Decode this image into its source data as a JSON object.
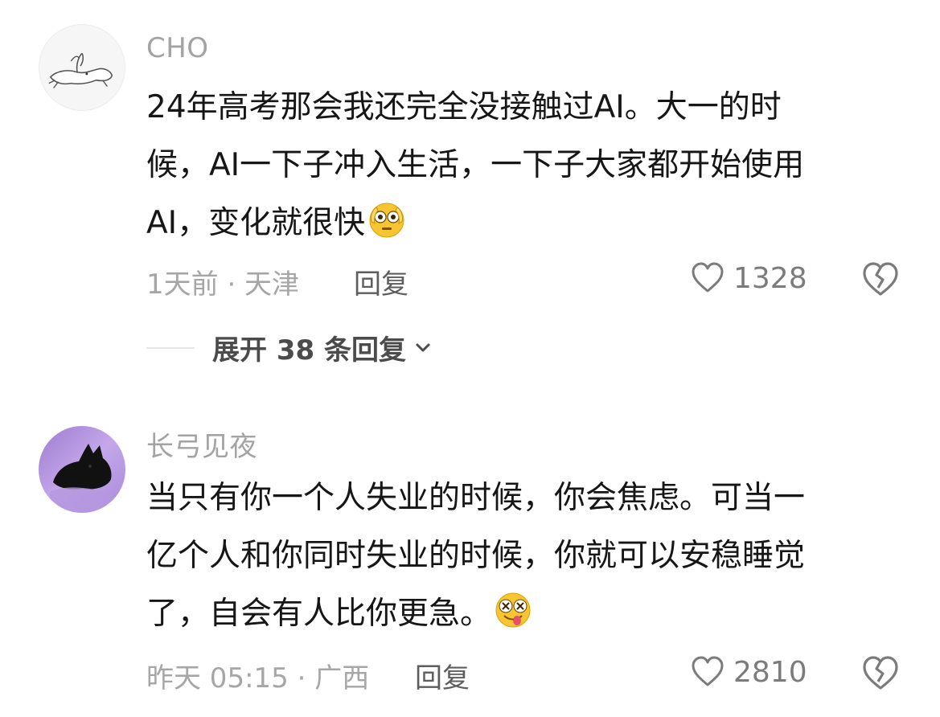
{
  "comments": [
    {
      "username": "CHO",
      "lines": [
        "24年高考那会我还完全没接触过AI。大一的时",
        "候，AI一下子冲入生活，一下子大家都开始使用",
        "AI，变化就很快"
      ],
      "emoji": "flushed-face-emoji",
      "meta": "1天前 · 天津",
      "reply_label": "回复",
      "like_count": "1328",
      "expand_label": "展开 38 条回复"
    },
    {
      "username": "长弓见夜",
      "lines": [
        "当只有你一个人失业的时候，你会焦虑。可当一",
        "亿个人和你同时失业的时候，你就可以安稳睡觉",
        "了，自会有人比你更急。"
      ],
      "emoji": "zany-face-emoji",
      "meta": "昨天 05:15 · 广西",
      "reply_label": "回复",
      "like_count": "2810"
    }
  ],
  "colors": {
    "username": "#a3a3a3",
    "body_text": "#161616",
    "meta_text": "#a6a6a6",
    "icon_gray": "#7b7b7b"
  }
}
